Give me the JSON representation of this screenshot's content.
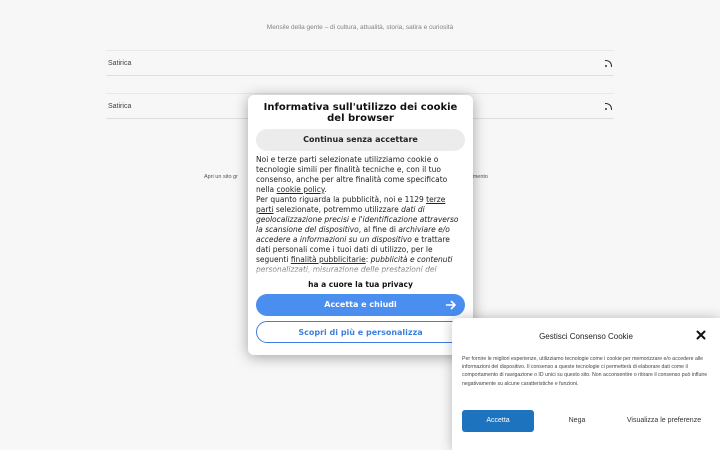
{
  "site": {
    "tagline": "Mensile della gente – di cultura, attualità, storia, satira e curiosità",
    "feeds": [
      {
        "label": "Satirica"
      },
      {
        "label": "Satirica"
      }
    ],
    "footer_left": "Apri un sito gr",
    "footer_right": "tracciamento"
  },
  "modal": {
    "title": "Informativa sull'utilizzo dei cookie del browser",
    "continue_label": "Continua senza accettare",
    "p1_a": "Noi e terze parti selezionate utilizziamo cookie o tecnologie simili per finalità tecniche e, con il tuo consenso, anche per altre finalità come specificato nella ",
    "p1_link": "cookie policy",
    "p1_b": ".",
    "p2_a": "Per quanto riguarda la pubblicità, noi e 1129 ",
    "p2_link1": "terze parti",
    "p2_b": " selezionate, potremmo utilizzare ",
    "p2_i1": "dati di geolocalizzazione precisi e l'identificazione attraverso la scansione del dispositivo",
    "p2_c": ", al fine di ",
    "p2_i2": "archiviare e/o accedere a informazioni su un dispositivo",
    "p2_d": " e trattare dati personali come i tuoi dati di utilizzo, per le seguenti ",
    "p2_link2": "finalità pubblicitarie",
    "p2_e": ": ",
    "p2_i3": "pubblicità e contenuti personalizzati, misurazione delle prestazioni dei contenuti e degli annunci, ricerche sul pubblico, sviluppo di servizi.",
    "privacy_line": "ha a cuore la tua privacy",
    "accept_label": "Accetta e chiudi",
    "learn_label": "Scopri di più e personalizza"
  },
  "consent": {
    "title": "Gestisci Consenso Cookie",
    "text": "Per fornire le migliori esperienze, utilizziamo tecnologie come i cookie per memorizzare e/o accedere alle informazioni del dispositivo. Il consenso a queste tecnologie ci permetterà di elaborare dati come il comportamento di navigazione o ID unici su questo sito. Non acconsentire o ritirare il consenso può influire negativamente su alcune caratteristiche e funzioni.",
    "accept_label": "Accetta",
    "deny_label": "Nega",
    "prefs_label": "Visualizza le preferenze"
  },
  "colors": {
    "accent_blue": "#4a8ef0",
    "consent_blue": "#1e73be"
  },
  "icons": [
    "rss-icon",
    "arrow-right-icon",
    "close-icon"
  ]
}
